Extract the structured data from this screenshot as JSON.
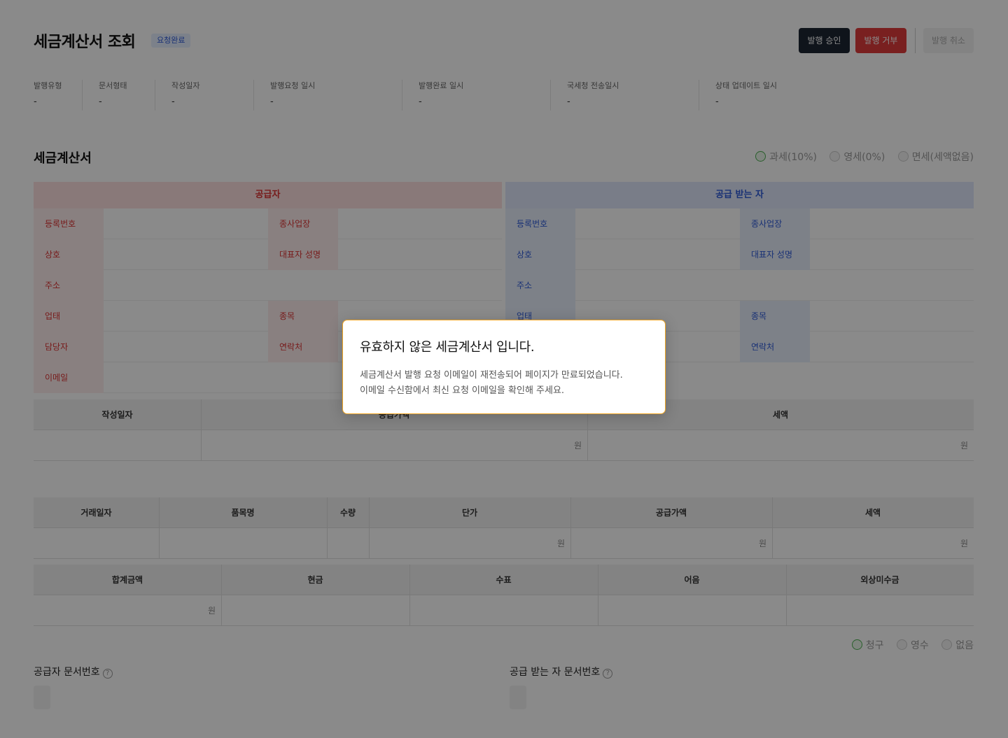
{
  "header": {
    "title": "세금계산서 조회",
    "status_badge": "요청완료",
    "approve_label": "발행 승인",
    "reject_label": "발행 거부",
    "cancel_label": "발행 취소"
  },
  "meta": [
    {
      "label": "발행유형",
      "value": "-"
    },
    {
      "label": "문서형태",
      "value": "-"
    },
    {
      "label": "작성일자",
      "value": "-"
    },
    {
      "label": "발행요청 일시",
      "value": "-"
    },
    {
      "label": "발행완료 일시",
      "value": "-"
    },
    {
      "label": "국세청 전송일시",
      "value": "-"
    },
    {
      "label": "상태 업데이트 일시",
      "value": "-"
    }
  ],
  "invoice": {
    "section_title": "세금계산서",
    "tax_types": [
      "과세(10%)",
      "영세(0%)",
      "면세(세액없음)"
    ],
    "selected_tax_type": "과세(10%)"
  },
  "supplier": {
    "title": "공급자",
    "labels": {
      "reg_no": "등록번호",
      "branch": "종사업장",
      "company": "상호",
      "ceo": "대표자 성명",
      "address": "주소",
      "biz_type": "업태",
      "biz_item": "종목",
      "manager": "담당자",
      "contact": "연락처",
      "email": "이메일"
    }
  },
  "receiver": {
    "title": "공급 받는 자",
    "labels": {
      "reg_no": "등록번호",
      "branch": "종사업장",
      "company": "상호",
      "ceo": "대표자 성명",
      "address": "주소",
      "biz_type": "업태",
      "biz_item": "종목",
      "contact": "연락처"
    }
  },
  "summary_table": {
    "headers": [
      "작성일자",
      "공급가액",
      "세액"
    ],
    "unit": "원"
  },
  "items_table": {
    "headers": [
      "거래일자",
      "품목명",
      "수량",
      "단가",
      "공급가액",
      "세액"
    ],
    "unit": "원"
  },
  "payment_table": {
    "headers": [
      "합계금액",
      "현금",
      "수표",
      "어음",
      "외상미수금"
    ],
    "unit": "원"
  },
  "receipt_types": [
    "청구",
    "영수",
    "없음"
  ],
  "selected_receipt_type": "청구",
  "doc_numbers": {
    "supplier_label": "공급자 문서번호",
    "receiver_label": "공급 받는 자 문서번호",
    "help": "?"
  },
  "modal": {
    "title": "유효하지 않은 세금계산서 입니다.",
    "line1": "세금계산서 발행 요청 이메일이 재전송되어 페이지가 만료되었습니다.",
    "line2": "이메일 수신함에서 최신 요청 이메일을 확인해 주세요."
  }
}
